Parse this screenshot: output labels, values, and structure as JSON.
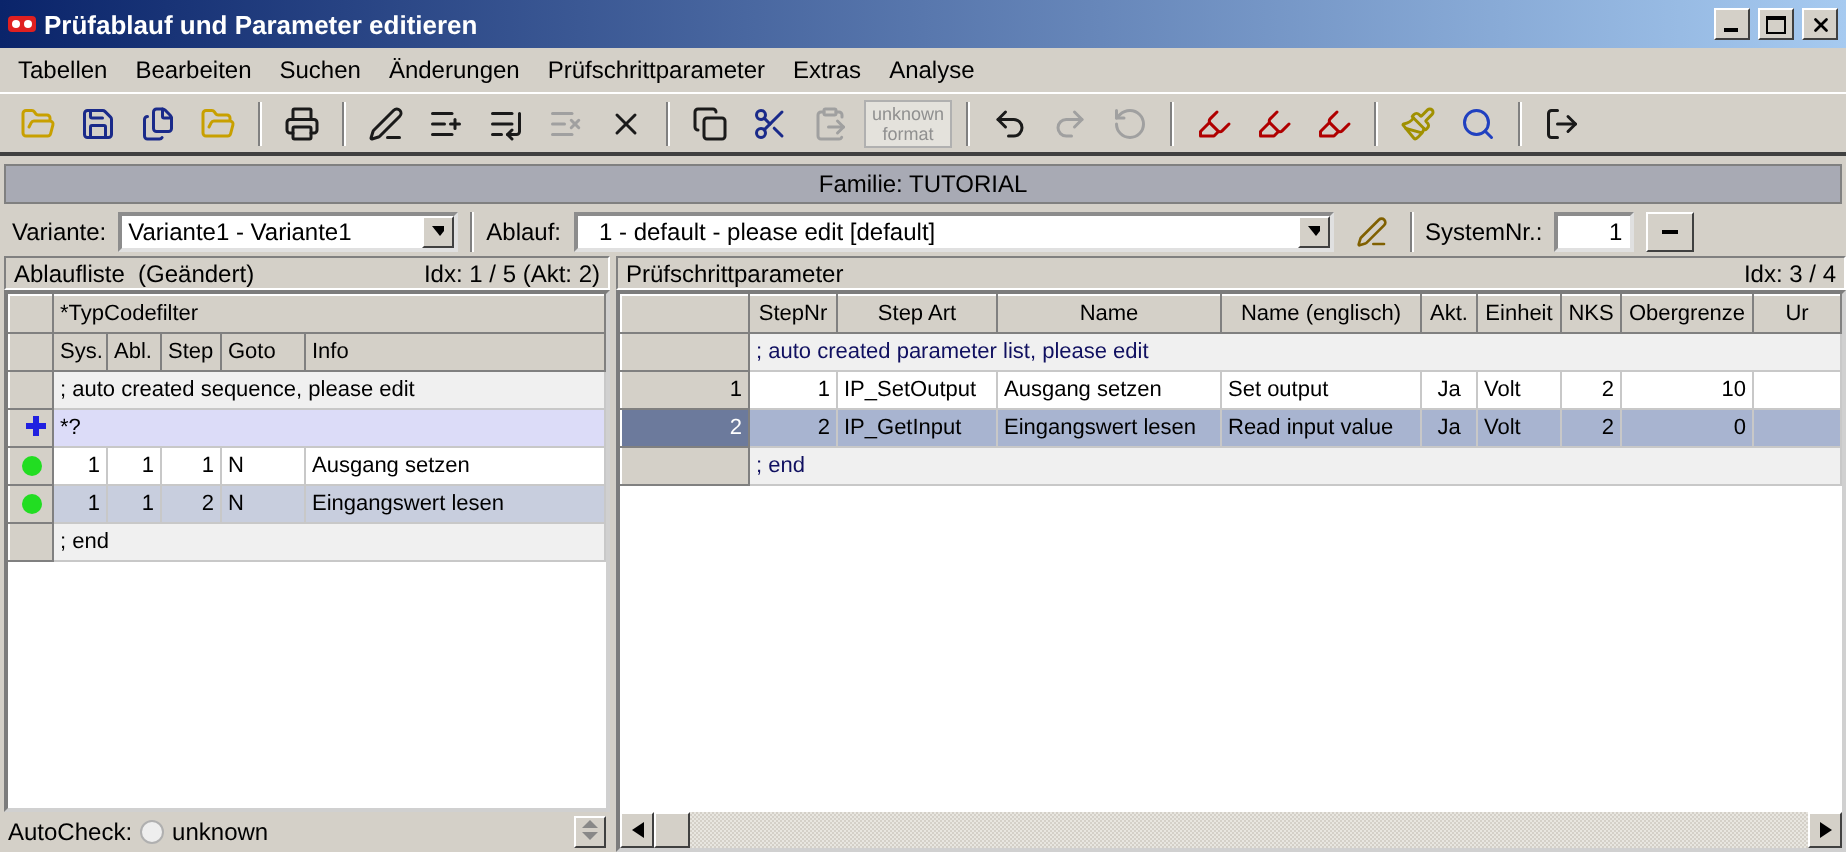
{
  "window": {
    "title": "Prüfablauf und Parameter editieren"
  },
  "menu": [
    "Tabellen",
    "Bearbeiten",
    "Suchen",
    "Änderungen",
    "Prüfschrittparameter",
    "Extras",
    "Analyse"
  ],
  "toolbar": [
    {
      "kind": "open",
      "disabled": false
    },
    {
      "kind": "save",
      "disabled": false
    },
    {
      "kind": "save-all",
      "disabled": false
    },
    {
      "kind": "open-up",
      "disabled": false
    },
    {
      "kind": "sep"
    },
    {
      "kind": "print",
      "disabled": false
    },
    {
      "kind": "sep"
    },
    {
      "kind": "edit",
      "disabled": false
    },
    {
      "kind": "insert",
      "disabled": false
    },
    {
      "kind": "insert-def",
      "disabled": false
    },
    {
      "kind": "insert-alt",
      "disabled": true
    },
    {
      "kind": "delete",
      "disabled": false
    },
    {
      "kind": "sep"
    },
    {
      "kind": "copy",
      "disabled": false
    },
    {
      "kind": "cut",
      "disabled": false
    },
    {
      "kind": "paste",
      "disabled": true
    },
    {
      "kind": "format",
      "disabled": true,
      "lines": [
        "unknown",
        "format"
      ]
    },
    {
      "kind": "sep"
    },
    {
      "kind": "undo",
      "disabled": false
    },
    {
      "kind": "redo",
      "disabled": true
    },
    {
      "kind": "undo-all",
      "disabled": true
    },
    {
      "kind": "sep"
    },
    {
      "kind": "marker",
      "disabled": false
    },
    {
      "kind": "marker-ab",
      "disabled": false
    },
    {
      "kind": "marker-dots",
      "disabled": false
    },
    {
      "kind": "sep"
    },
    {
      "kind": "broom",
      "disabled": false
    },
    {
      "kind": "search",
      "disabled": false
    },
    {
      "kind": "sep"
    },
    {
      "kind": "exit",
      "disabled": false
    }
  ],
  "family": "Familie: TUTORIAL",
  "selectors": {
    "variante_label": "Variante:",
    "variante": "Variante1 - Variante1",
    "ablauf_label": "Ablauf:",
    "ablauf": "1 - default - please edit [default]",
    "system_label": "SystemNr.:",
    "system": "1"
  },
  "left": {
    "title": "Ablaufliste  (Geändert)",
    "index": "Idx: 1 / 5 (Akt: 2)",
    "filter": "*TypCodefilter",
    "columns": [
      "Sys.",
      "Abl.",
      "Step",
      "Goto",
      "Info"
    ],
    "rows": [
      {
        "kind": "comment",
        "text": "; auto created sequence, please edit",
        "selected": false
      },
      {
        "kind": "filter",
        "text": "*?",
        "selected": false
      },
      {
        "kind": "step",
        "cells": [
          "1",
          "1",
          "1",
          "N",
          "Ausgang setzen"
        ],
        "selected": false
      },
      {
        "kind": "step",
        "cells": [
          "1",
          "1",
          "2",
          "N",
          "Eingangswert lesen"
        ],
        "selected": true
      },
      {
        "kind": "comment",
        "text": "; end",
        "selected": false
      }
    ],
    "autocheck_label": "AutoCheck:",
    "autocheck": {
      "label": "unknown",
      "checked": false
    }
  },
  "right": {
    "title": "Prüfschrittparameter",
    "index": "Idx: 3 / 4",
    "columns": [
      "StepNr",
      "Step Art",
      "Name",
      "Name (englisch)",
      "Akt.",
      "Einheit",
      "NKS",
      "Obergrenze",
      "Ur"
    ],
    "rows": [
      {
        "kind": "comment",
        "text": "; auto created parameter list, please edit",
        "selected": false
      },
      {
        "kind": "step",
        "header": "1",
        "cells": [
          "1",
          "IP_SetOutput",
          "Ausgang setzen",
          "Set output",
          "Ja",
          "Volt",
          "2",
          "10",
          ""
        ],
        "selected": false
      },
      {
        "kind": "step",
        "header": "2",
        "cells": [
          "2",
          "IP_GetInput",
          "Eingangswert lesen",
          "Read input value",
          "Ja",
          "Volt",
          "2",
          "0",
          ""
        ],
        "selected": true
      },
      {
        "kind": "comment",
        "text": "; end",
        "selected": false
      }
    ]
  }
}
